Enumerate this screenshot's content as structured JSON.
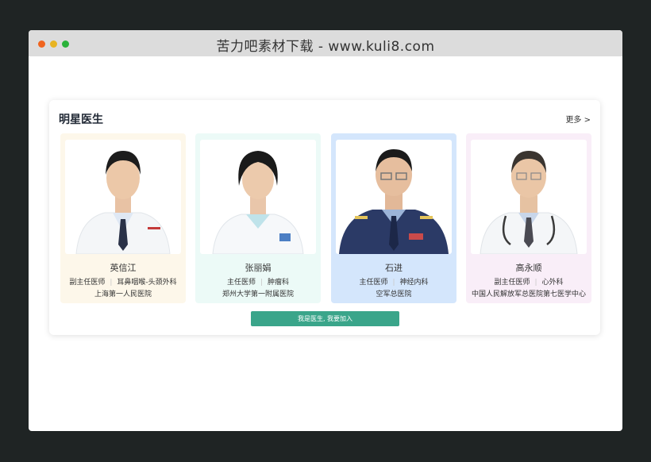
{
  "window": {
    "title": "苦力吧素材下载 - www.kuli8.com"
  },
  "section": {
    "title": "明星医生",
    "more_label": "更多 >",
    "join_button": "我是医生, 我要加入"
  },
  "colors": {
    "card_bg_1": "#fdf7ea",
    "card_bg_2": "#ecfaf7",
    "card_bg_3": "#d4e6fc",
    "card_bg_4": "#f9eef8",
    "accent_button": "#3aa58a"
  },
  "doctors": [
    {
      "name": "英信江",
      "title": "副主任医师",
      "department": "耳鼻咽喉-头颈外科",
      "hospital": "上海第一人民医院"
    },
    {
      "name": "张丽娟",
      "title": "主任医师",
      "department": "肿瘤科",
      "hospital": "郑州大学第一附属医院"
    },
    {
      "name": "石进",
      "title": "主任医师",
      "department": "神经内科",
      "hospital": "空军总医院"
    },
    {
      "name": "高永顺",
      "title": "副主任医师",
      "department": "心外科",
      "hospital": "中国人民解放军总医院第七医学中心"
    }
  ]
}
